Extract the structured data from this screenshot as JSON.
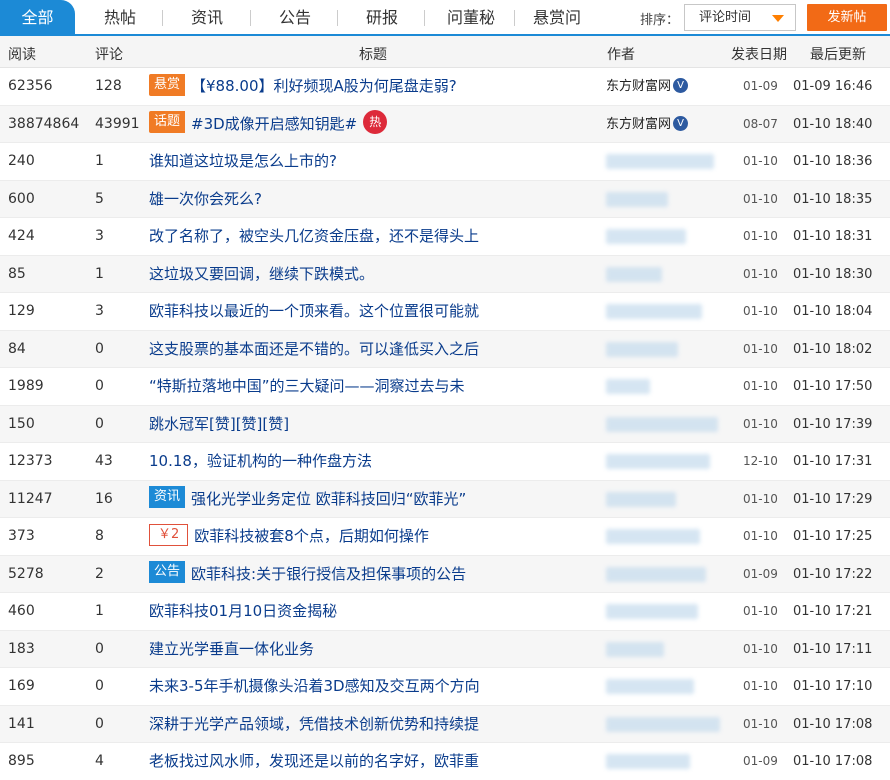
{
  "tabs": [
    "全部",
    "热帖",
    "资讯",
    "公告",
    "研报",
    "问董秘",
    "悬赏问"
  ],
  "sort": {
    "label": "排序：",
    "value": "评论时间"
  },
  "post_button": "发新帖",
  "columns": {
    "read": "阅读",
    "comments": "评论",
    "title": "标题",
    "author": "作者",
    "published": "发表日期",
    "updated": "最后更新"
  },
  "hot_icon_label": "热",
  "rows": [
    {
      "read": "62356",
      "comments": "128",
      "tag": "悬赏",
      "tag_style": "orange",
      "title": "【¥88.00】利好频现A股为何尾盘走弱?",
      "author": "东方财富网",
      "verified": true,
      "published": "01-09",
      "updated": "01-09 16:46"
    },
    {
      "read": "38874864",
      "comments": "43991",
      "tag": "话题",
      "tag_style": "orange",
      "title": "#3D成像开启感知钥匙#",
      "hot": true,
      "author": "东方财富网",
      "verified": true,
      "published": "08-07",
      "updated": "01-10 18:40"
    },
    {
      "read": "240",
      "comments": "1",
      "title": "谁知道这垃圾是怎么上市的?",
      "author": "",
      "published": "01-10",
      "updated": "01-10 18:36"
    },
    {
      "read": "600",
      "comments": "5",
      "title": "雄一次你会死么?",
      "author": "",
      "published": "01-10",
      "updated": "01-10 18:35"
    },
    {
      "read": "424",
      "comments": "3",
      "title": "改了名称了，被空头几亿资金压盘，还不是得头上",
      "author": "",
      "published": "01-10",
      "updated": "01-10 18:31"
    },
    {
      "read": "85",
      "comments": "1",
      "title": "这垃圾又要回调，继续下跌模式。",
      "author": "",
      "published": "01-10",
      "updated": "01-10 18:30"
    },
    {
      "read": "129",
      "comments": "3",
      "title": "欧菲科技以最近的一个顶来看。这个位置很可能就",
      "author": "",
      "published": "01-10",
      "updated": "01-10 18:04"
    },
    {
      "read": "84",
      "comments": "0",
      "title": "这支股票的基本面还是不错的。可以逢低买入之后",
      "author": "",
      "published": "01-10",
      "updated": "01-10 18:02"
    },
    {
      "read": "1989",
      "comments": "0",
      "title": "“特斯拉落地中国”的三大疑问——洞察过去与未",
      "author": "",
      "published": "01-10",
      "updated": "01-10 17:50"
    },
    {
      "read": "150",
      "comments": "0",
      "title": "跳水冠军[赞][赞][赞]",
      "author": "",
      "published": "01-10",
      "updated": "01-10 17:39"
    },
    {
      "read": "12373",
      "comments": "43",
      "title": "10.18，验证机构的一种作盘方法",
      "author": "",
      "published": "12-10",
      "updated": "01-10 17:31"
    },
    {
      "read": "11247",
      "comments": "16",
      "tag": "资讯",
      "tag_style": "blue",
      "title": "强化光学业务定位 欧菲科技回归“欧菲光”",
      "author": "",
      "published": "01-10",
      "updated": "01-10 17:29"
    },
    {
      "read": "373",
      "comments": "8",
      "tag": "￥2",
      "tag_style": "outline",
      "title": "欧菲科技被套8个点，后期如何操作",
      "author": "",
      "published": "01-10",
      "updated": "01-10 17:25"
    },
    {
      "read": "5278",
      "comments": "2",
      "tag": "公告",
      "tag_style": "blue",
      "title": "欧菲科技:关于银行授信及担保事项的公告",
      "author": "",
      "published": "01-09",
      "updated": "01-10 17:22"
    },
    {
      "read": "460",
      "comments": "1",
      "title": "欧菲科技01月10日资金揭秘",
      "author": "",
      "published": "01-10",
      "updated": "01-10 17:21"
    },
    {
      "read": "183",
      "comments": "0",
      "title": "建立光学垂直一体化业务",
      "author": "",
      "published": "01-10",
      "updated": "01-10 17:11"
    },
    {
      "read": "169",
      "comments": "0",
      "title": "未来3-5年手机摄像头沿着3D感知及交互两个方向",
      "author": "",
      "published": "01-10",
      "updated": "01-10 17:10"
    },
    {
      "read": "141",
      "comments": "0",
      "title": "深耕于光学产品领域，凭借技术创新优势和持续提",
      "author": "",
      "published": "01-10",
      "updated": "01-10 17:08"
    },
    {
      "read": "895",
      "comments": "4",
      "title": "老板找过风水师，发现还是以前的名字好，欧菲重",
      "author": "",
      "published": "01-09",
      "updated": "01-10 17:08"
    }
  ]
}
